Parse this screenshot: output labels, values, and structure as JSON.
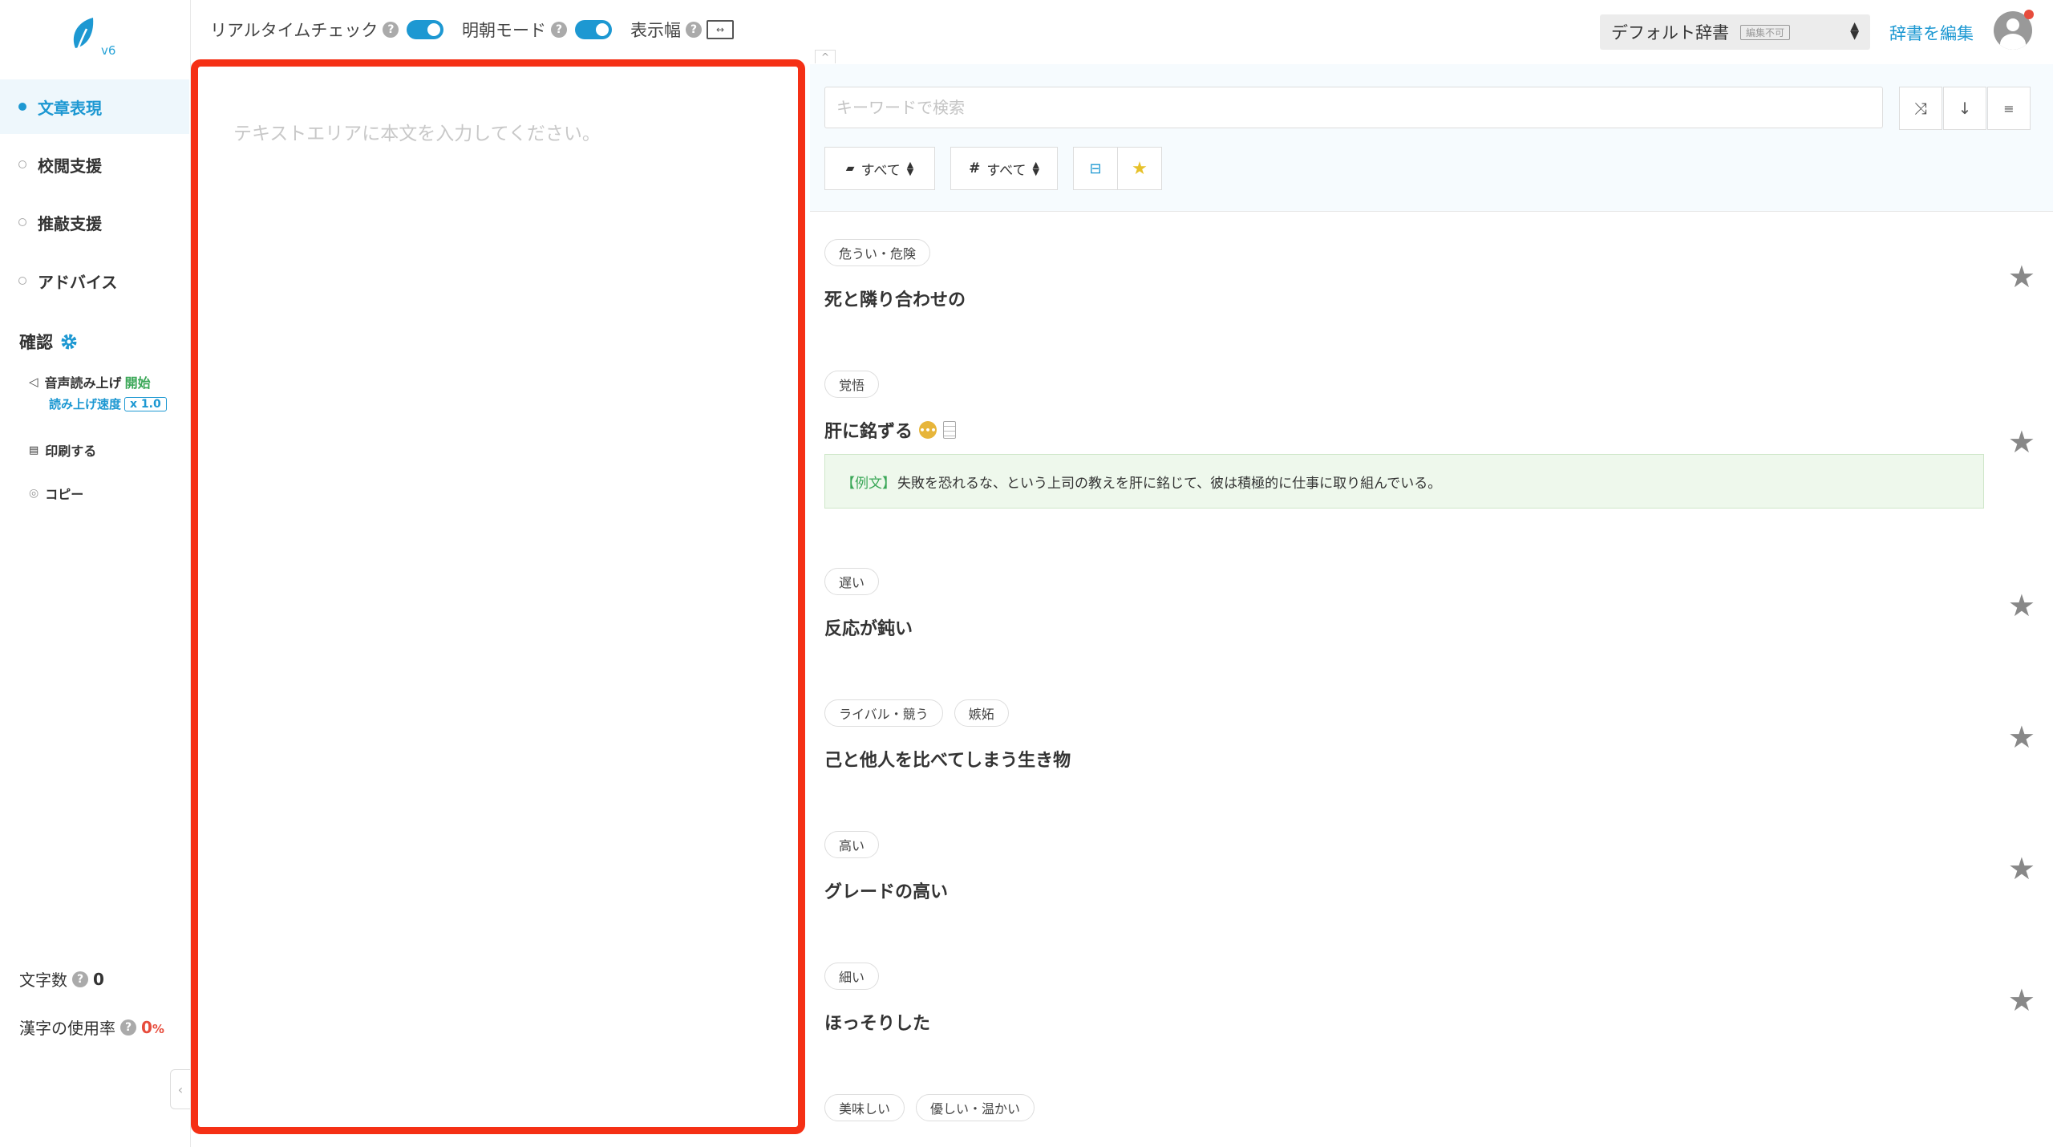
{
  "app": {
    "version": "v6",
    "colors": {
      "accent": "#1d98d2",
      "highlight": "#f53015",
      "success": "#3aa757"
    }
  },
  "sidebar": {
    "nav": [
      {
        "label": "文章表現",
        "active": true
      },
      {
        "label": "校閲支援",
        "active": false
      },
      {
        "label": "推敲支援",
        "active": false
      },
      {
        "label": "アドバイス",
        "active": false
      }
    ],
    "confirm": {
      "title": "確認",
      "tts_label": "音声読み上げ",
      "tts_start": "開始",
      "speed_label": "読み上げ速度",
      "speed_value": "x 1.0",
      "print": "印刷する",
      "copy": "コピー"
    },
    "stats": {
      "char_count_label": "文字数",
      "char_count": "0",
      "kanji_rate_label": "漢字の使用率",
      "kanji_rate": "0",
      "kanji_rate_unit": "%"
    }
  },
  "topbar": {
    "realtime_check": "リアルタイムチェック",
    "mincho_mode": "明朝モード",
    "display_width": "表示幅",
    "help": "?",
    "dict_select": "デフォルト辞書",
    "dict_badge": "編集不可",
    "edit_dict": "辞書を編集"
  },
  "editor": {
    "placeholder": "テキストエリアに本文を入力してください。",
    "value": ""
  },
  "search": {
    "placeholder": "キーワードで検索",
    "filter_category": "すべて",
    "filter_tag": "すべて"
  },
  "entries": [
    {
      "tags": [
        "危うい・危険"
      ],
      "text": "死と隣り合わせの"
    },
    {
      "tags": [
        "覚悟"
      ],
      "text": "肝に銘ずる",
      "example_label": "【例文】",
      "example": "失敗を恐れるな、という上司の教えを肝に銘じて、彼は積極的に仕事に取り組んでいる。"
    },
    {
      "tags": [
        "遅い"
      ],
      "text": "反応が鈍い"
    },
    {
      "tags": [
        "ライバル・競う",
        "嫉妬"
      ],
      "text": "己と他人を比べてしまう生き物"
    },
    {
      "tags": [
        "高い"
      ],
      "text": "グレードの高い"
    },
    {
      "tags": [
        "細い"
      ],
      "text": "ほっそりした"
    },
    {
      "tags": [
        "美味しい",
        "優しい・温かい"
      ],
      "text": ""
    }
  ]
}
